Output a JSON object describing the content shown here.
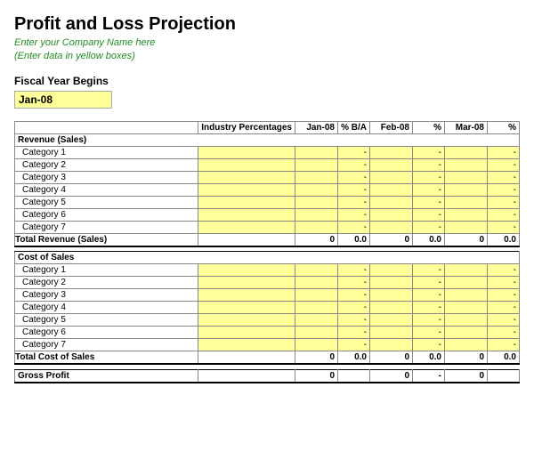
{
  "title": "Profit and Loss Projection",
  "subtitle_line1": "Enter your Company Name here",
  "subtitle_line2": "(Enter data in yellow boxes)",
  "fiscal_label": "Fiscal Year Begins",
  "fiscal_value": "Jan-08",
  "headers": {
    "industry": "Industry Percentages",
    "jan08": "Jan-08",
    "pct_ba": "% B/A",
    "feb08": "Feb-08",
    "pct": "%",
    "mar08": "Mar-08",
    "pct2": "%"
  },
  "revenue_section": "Revenue (Sales)",
  "revenue_categories": [
    "Category 1",
    "Category 2",
    "Category 3",
    "Category 4",
    "Category 5",
    "Category 6",
    "Category 7"
  ],
  "total_revenue": "Total Revenue (Sales)",
  "total_revenue_values": [
    "0",
    "0.0",
    "0",
    "0.0",
    "0",
    "0.0"
  ],
  "cos_section": "Cost of Sales",
  "cos_categories": [
    "Category 1",
    "Category 2",
    "Category 3",
    "Category 4",
    "Category 5",
    "Category 6",
    "Category 7"
  ],
  "total_cos": "Total Cost of Sales",
  "total_cos_values": [
    "0",
    "0.0",
    "0",
    "0.0",
    "0",
    "0.0"
  ],
  "gross_profit": "Gross Profit",
  "gross_profit_values": [
    "0",
    "",
    "0",
    "-",
    "0",
    ""
  ]
}
